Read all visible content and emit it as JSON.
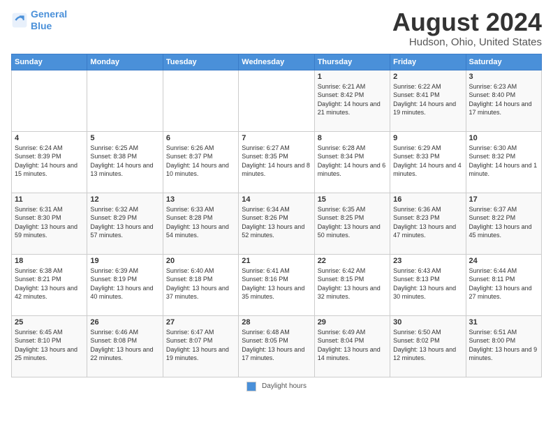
{
  "header": {
    "logo_line1": "General",
    "logo_line2": "Blue",
    "month": "August 2024",
    "location": "Hudson, Ohio, United States"
  },
  "weekdays": [
    "Sunday",
    "Monday",
    "Tuesday",
    "Wednesday",
    "Thursday",
    "Friday",
    "Saturday"
  ],
  "footer": {
    "legend_label": "Daylight hours"
  },
  "weeks": [
    [
      {
        "day": "",
        "sunrise": "",
        "sunset": "",
        "daylight": ""
      },
      {
        "day": "",
        "sunrise": "",
        "sunset": "",
        "daylight": ""
      },
      {
        "day": "",
        "sunrise": "",
        "sunset": "",
        "daylight": ""
      },
      {
        "day": "",
        "sunrise": "",
        "sunset": "",
        "daylight": ""
      },
      {
        "day": "1",
        "sunrise": "Sunrise: 6:21 AM",
        "sunset": "Sunset: 8:42 PM",
        "daylight": "Daylight: 14 hours and 21 minutes."
      },
      {
        "day": "2",
        "sunrise": "Sunrise: 6:22 AM",
        "sunset": "Sunset: 8:41 PM",
        "daylight": "Daylight: 14 hours and 19 minutes."
      },
      {
        "day": "3",
        "sunrise": "Sunrise: 6:23 AM",
        "sunset": "Sunset: 8:40 PM",
        "daylight": "Daylight: 14 hours and 17 minutes."
      }
    ],
    [
      {
        "day": "4",
        "sunrise": "Sunrise: 6:24 AM",
        "sunset": "Sunset: 8:39 PM",
        "daylight": "Daylight: 14 hours and 15 minutes."
      },
      {
        "day": "5",
        "sunrise": "Sunrise: 6:25 AM",
        "sunset": "Sunset: 8:38 PM",
        "daylight": "Daylight: 14 hours and 13 minutes."
      },
      {
        "day": "6",
        "sunrise": "Sunrise: 6:26 AM",
        "sunset": "Sunset: 8:37 PM",
        "daylight": "Daylight: 14 hours and 10 minutes."
      },
      {
        "day": "7",
        "sunrise": "Sunrise: 6:27 AM",
        "sunset": "Sunset: 8:35 PM",
        "daylight": "Daylight: 14 hours and 8 minutes."
      },
      {
        "day": "8",
        "sunrise": "Sunrise: 6:28 AM",
        "sunset": "Sunset: 8:34 PM",
        "daylight": "Daylight: 14 hours and 6 minutes."
      },
      {
        "day": "9",
        "sunrise": "Sunrise: 6:29 AM",
        "sunset": "Sunset: 8:33 PM",
        "daylight": "Daylight: 14 hours and 4 minutes."
      },
      {
        "day": "10",
        "sunrise": "Sunrise: 6:30 AM",
        "sunset": "Sunset: 8:32 PM",
        "daylight": "Daylight: 14 hours and 1 minute."
      }
    ],
    [
      {
        "day": "11",
        "sunrise": "Sunrise: 6:31 AM",
        "sunset": "Sunset: 8:30 PM",
        "daylight": "Daylight: 13 hours and 59 minutes."
      },
      {
        "day": "12",
        "sunrise": "Sunrise: 6:32 AM",
        "sunset": "Sunset: 8:29 PM",
        "daylight": "Daylight: 13 hours and 57 minutes."
      },
      {
        "day": "13",
        "sunrise": "Sunrise: 6:33 AM",
        "sunset": "Sunset: 8:28 PM",
        "daylight": "Daylight: 13 hours and 54 minutes."
      },
      {
        "day": "14",
        "sunrise": "Sunrise: 6:34 AM",
        "sunset": "Sunset: 8:26 PM",
        "daylight": "Daylight: 13 hours and 52 minutes."
      },
      {
        "day": "15",
        "sunrise": "Sunrise: 6:35 AM",
        "sunset": "Sunset: 8:25 PM",
        "daylight": "Daylight: 13 hours and 50 minutes."
      },
      {
        "day": "16",
        "sunrise": "Sunrise: 6:36 AM",
        "sunset": "Sunset: 8:23 PM",
        "daylight": "Daylight: 13 hours and 47 minutes."
      },
      {
        "day": "17",
        "sunrise": "Sunrise: 6:37 AM",
        "sunset": "Sunset: 8:22 PM",
        "daylight": "Daylight: 13 hours and 45 minutes."
      }
    ],
    [
      {
        "day": "18",
        "sunrise": "Sunrise: 6:38 AM",
        "sunset": "Sunset: 8:21 PM",
        "daylight": "Daylight: 13 hours and 42 minutes."
      },
      {
        "day": "19",
        "sunrise": "Sunrise: 6:39 AM",
        "sunset": "Sunset: 8:19 PM",
        "daylight": "Daylight: 13 hours and 40 minutes."
      },
      {
        "day": "20",
        "sunrise": "Sunrise: 6:40 AM",
        "sunset": "Sunset: 8:18 PM",
        "daylight": "Daylight: 13 hours and 37 minutes."
      },
      {
        "day": "21",
        "sunrise": "Sunrise: 6:41 AM",
        "sunset": "Sunset: 8:16 PM",
        "daylight": "Daylight: 13 hours and 35 minutes."
      },
      {
        "day": "22",
        "sunrise": "Sunrise: 6:42 AM",
        "sunset": "Sunset: 8:15 PM",
        "daylight": "Daylight: 13 hours and 32 minutes."
      },
      {
        "day": "23",
        "sunrise": "Sunrise: 6:43 AM",
        "sunset": "Sunset: 8:13 PM",
        "daylight": "Daylight: 13 hours and 30 minutes."
      },
      {
        "day": "24",
        "sunrise": "Sunrise: 6:44 AM",
        "sunset": "Sunset: 8:11 PM",
        "daylight": "Daylight: 13 hours and 27 minutes."
      }
    ],
    [
      {
        "day": "25",
        "sunrise": "Sunrise: 6:45 AM",
        "sunset": "Sunset: 8:10 PM",
        "daylight": "Daylight: 13 hours and 25 minutes."
      },
      {
        "day": "26",
        "sunrise": "Sunrise: 6:46 AM",
        "sunset": "Sunset: 8:08 PM",
        "daylight": "Daylight: 13 hours and 22 minutes."
      },
      {
        "day": "27",
        "sunrise": "Sunrise: 6:47 AM",
        "sunset": "Sunset: 8:07 PM",
        "daylight": "Daylight: 13 hours and 19 minutes."
      },
      {
        "day": "28",
        "sunrise": "Sunrise: 6:48 AM",
        "sunset": "Sunset: 8:05 PM",
        "daylight": "Daylight: 13 hours and 17 minutes."
      },
      {
        "day": "29",
        "sunrise": "Sunrise: 6:49 AM",
        "sunset": "Sunset: 8:04 PM",
        "daylight": "Daylight: 13 hours and 14 minutes."
      },
      {
        "day": "30",
        "sunrise": "Sunrise: 6:50 AM",
        "sunset": "Sunset: 8:02 PM",
        "daylight": "Daylight: 13 hours and 12 minutes."
      },
      {
        "day": "31",
        "sunrise": "Sunrise: 6:51 AM",
        "sunset": "Sunset: 8:00 PM",
        "daylight": "Daylight: 13 hours and 9 minutes."
      }
    ]
  ]
}
